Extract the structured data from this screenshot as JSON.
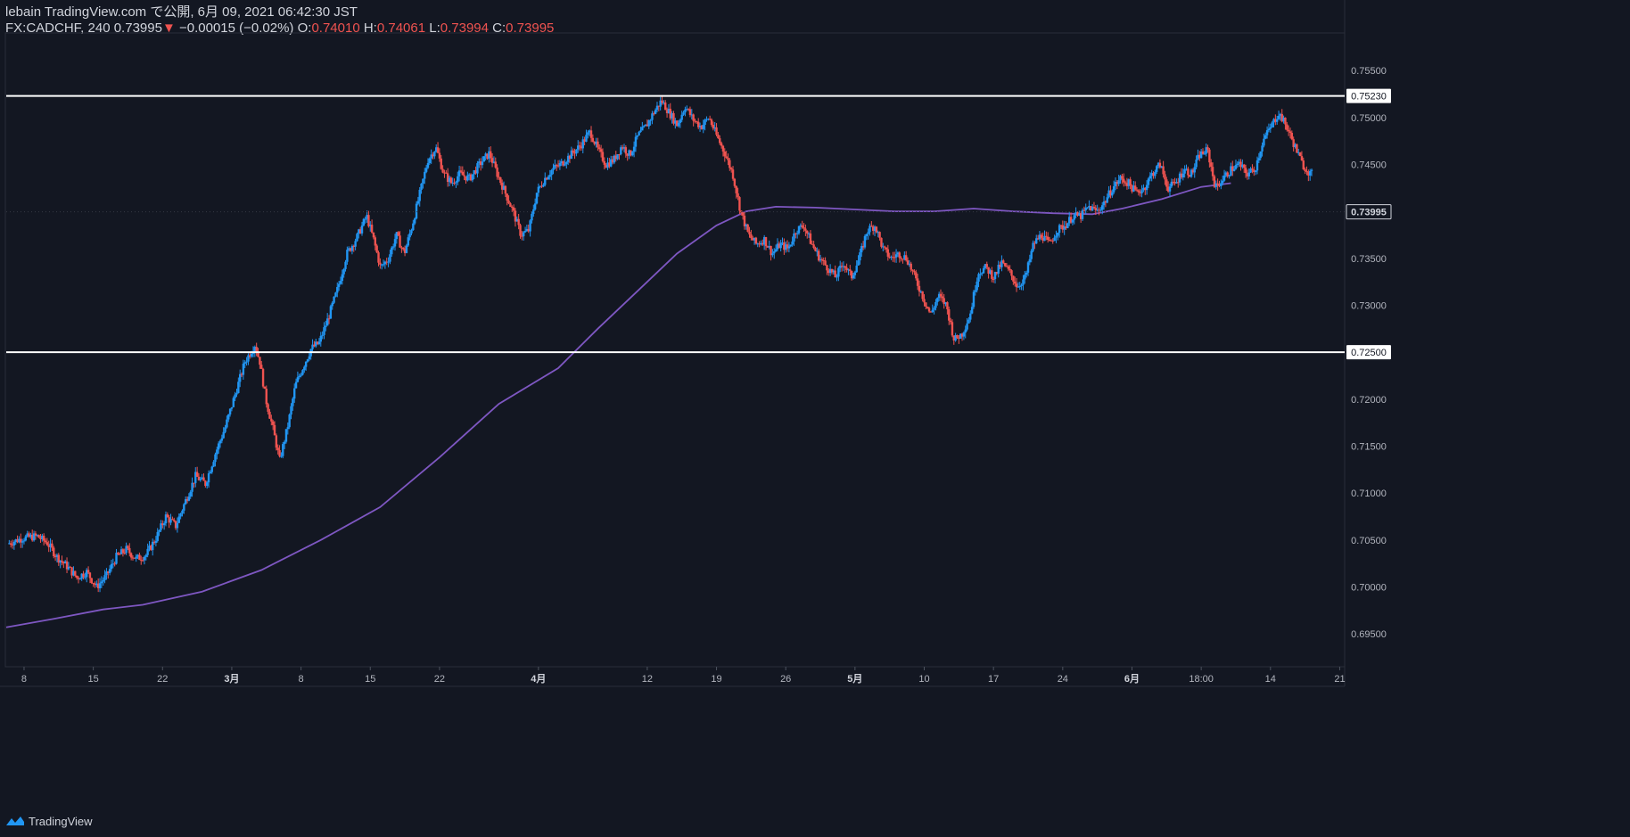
{
  "header": {
    "line1": "lebain TradingView.com で公開, 6月 09, 2021 06:42:30 JST",
    "symbol": "FX:CADCHF, 240",
    "last": "0.73995",
    "down_arrow": "▼",
    "change": "−0.00015 (−0.02%)",
    "o_label": "O:",
    "o_value": "0.74010",
    "h_label": "H:",
    "h_value": "0.74061",
    "l_label": "L:",
    "l_value": "0.73994",
    "c_label": "C:",
    "c_value": "0.73995"
  },
  "footer": {
    "brand": "TradingView"
  },
  "colors": {
    "background": "#131722",
    "up": "#2196f3",
    "down": "#ef5350",
    "ma": "#7e57c2",
    "hline": "#ffffff",
    "axis_text": "#b2b5be"
  },
  "chart_data": {
    "type": "candlestick",
    "symbol": "FX:CADCHF",
    "interval": "240",
    "ylim": [
      0.6915,
      0.759
    ],
    "y_ticks": [
      "0.75500",
      "0.75000",
      "0.74500",
      "0.74000",
      "0.73500",
      "0.73000",
      "0.72500",
      "0.72000",
      "0.71500",
      "0.71000",
      "0.70500",
      "0.70000",
      "0.69500"
    ],
    "x_ticks": [
      "8",
      "15",
      "22",
      "3月",
      "8",
      "15",
      "22",
      "4月",
      "12",
      "19",
      "26",
      "5月",
      "10",
      "17",
      "24",
      "6月",
      "18:00",
      "14",
      "21"
    ],
    "x_tick_days": [
      0,
      7,
      14,
      21,
      28,
      35,
      42,
      52,
      63,
      70,
      77,
      84,
      91,
      98,
      105,
      112,
      119,
      126,
      133
    ],
    "x_range_days": [
      -1.8,
      133.5
    ],
    "horizontal_lines": [
      {
        "value": 0.7523,
        "label": "0.75230"
      },
      {
        "value": 0.725,
        "label": "0.72500"
      }
    ],
    "last_price": {
      "value": 0.73995,
      "label": "0.73995"
    },
    "ma_points": [
      [
        -1.8,
        0.6957
      ],
      [
        3,
        0.6966
      ],
      [
        8,
        0.6976
      ],
      [
        12,
        0.6981
      ],
      [
        18,
        0.6995
      ],
      [
        24,
        0.7018
      ],
      [
        30,
        0.705
      ],
      [
        36,
        0.7085
      ],
      [
        42,
        0.7138
      ],
      [
        48,
        0.7195
      ],
      [
        54,
        0.7233
      ],
      [
        58,
        0.7275
      ],
      [
        62,
        0.7315
      ],
      [
        66,
        0.7355
      ],
      [
        70,
        0.7385
      ],
      [
        73,
        0.74
      ],
      [
        76,
        0.7405
      ],
      [
        80,
        0.7404
      ],
      [
        84,
        0.7402
      ],
      [
        88,
        0.74
      ],
      [
        92,
        0.74
      ],
      [
        96,
        0.7403
      ],
      [
        100,
        0.74
      ],
      [
        104,
        0.7398
      ],
      [
        108,
        0.7397
      ],
      [
        111,
        0.7403
      ],
      [
        115,
        0.7413
      ],
      [
        119,
        0.7426
      ],
      [
        122,
        0.743
      ]
    ],
    "price_path": [
      [
        -1.5,
        0.7046
      ],
      [
        0,
        0.7052
      ],
      [
        1.5,
        0.7054
      ],
      [
        2.5,
        0.7047
      ],
      [
        3.5,
        0.7032
      ],
      [
        4.5,
        0.7022
      ],
      [
        5.5,
        0.701
      ],
      [
        6.5,
        0.7016
      ],
      [
        7.5,
        0.7
      ],
      [
        8.5,
        0.7012
      ],
      [
        9.5,
        0.7032
      ],
      [
        10.5,
        0.704
      ],
      [
        11.5,
        0.703
      ],
      [
        12.5,
        0.7034
      ],
      [
        13.5,
        0.7052
      ],
      [
        14.5,
        0.7075
      ],
      [
        15.5,
        0.7065
      ],
      [
        16.5,
        0.7092
      ],
      [
        17.5,
        0.7118
      ],
      [
        18.5,
        0.711
      ],
      [
        19.5,
        0.7142
      ],
      [
        20.5,
        0.717
      ],
      [
        21.5,
        0.7205
      ],
      [
        22.5,
        0.724
      ],
      [
        23.5,
        0.7258
      ],
      [
        24,
        0.724
      ],
      [
        24.6,
        0.72
      ],
      [
        25.3,
        0.717
      ],
      [
        26,
        0.7135
      ],
      [
        26.8,
        0.717
      ],
      [
        27.6,
        0.7215
      ],
      [
        28.4,
        0.7235
      ],
      [
        29.2,
        0.7254
      ],
      [
        30,
        0.726
      ],
      [
        30.8,
        0.7283
      ],
      [
        31.8,
        0.7315
      ],
      [
        32.8,
        0.7355
      ],
      [
        33.8,
        0.7372
      ],
      [
        34.8,
        0.7395
      ],
      [
        35.5,
        0.737
      ],
      [
        36.2,
        0.734
      ],
      [
        37,
        0.735
      ],
      [
        37.8,
        0.7375
      ],
      [
        38.6,
        0.7355
      ],
      [
        39.4,
        0.7385
      ],
      [
        40.2,
        0.742
      ],
      [
        41,
        0.7455
      ],
      [
        41.8,
        0.7468
      ],
      [
        42.6,
        0.744
      ],
      [
        43.4,
        0.743
      ],
      [
        44.2,
        0.744
      ],
      [
        45.2,
        0.7435
      ],
      [
        46.2,
        0.745
      ],
      [
        47.2,
        0.7462
      ],
      [
        48,
        0.744
      ],
      [
        48.8,
        0.742
      ],
      [
        49.6,
        0.74
      ],
      [
        50.4,
        0.7375
      ],
      [
        51.2,
        0.738
      ],
      [
        52,
        0.742
      ],
      [
        52.8,
        0.7435
      ],
      [
        53.6,
        0.7445
      ],
      [
        54.4,
        0.745
      ],
      [
        55.4,
        0.746
      ],
      [
        56.4,
        0.747
      ],
      [
        57.4,
        0.7485
      ],
      [
        58.2,
        0.7465
      ],
      [
        59,
        0.745
      ],
      [
        59.8,
        0.7455
      ],
      [
        60.6,
        0.747
      ],
      [
        61.4,
        0.746
      ],
      [
        62.2,
        0.748
      ],
      [
        63,
        0.749
      ],
      [
        63.8,
        0.7505
      ],
      [
        64.6,
        0.7518
      ],
      [
        65.4,
        0.7505
      ],
      [
        66.2,
        0.7492
      ],
      [
        67,
        0.7512
      ],
      [
        67.8,
        0.7498
      ],
      [
        68.6,
        0.749
      ],
      [
        69.4,
        0.75
      ],
      [
        70.2,
        0.748
      ],
      [
        71,
        0.7462
      ],
      [
        71.8,
        0.744
      ],
      [
        72.6,
        0.74
      ],
      [
        73.4,
        0.7375
      ],
      [
        74.2,
        0.7365
      ],
      [
        75,
        0.737
      ],
      [
        75.8,
        0.7355
      ],
      [
        76.6,
        0.7365
      ],
      [
        77.4,
        0.736
      ],
      [
        78.2,
        0.738
      ],
      [
        79,
        0.7385
      ],
      [
        79.8,
        0.7365
      ],
      [
        80.6,
        0.735
      ],
      [
        81.4,
        0.734
      ],
      [
        82.2,
        0.733
      ],
      [
        83,
        0.7345
      ],
      [
        83.8,
        0.733
      ],
      [
        84.6,
        0.735
      ],
      [
        85.4,
        0.738
      ],
      [
        86.2,
        0.7385
      ],
      [
        87,
        0.736
      ],
      [
        87.8,
        0.735
      ],
      [
        88.6,
        0.7355
      ],
      [
        89.4,
        0.735
      ],
      [
        90.2,
        0.733
      ],
      [
        91,
        0.731
      ],
      [
        91.8,
        0.729
      ],
      [
        92.6,
        0.731
      ],
      [
        93.4,
        0.73
      ],
      [
        94.2,
        0.7263
      ],
      [
        95,
        0.727
      ],
      [
        95.8,
        0.729
      ],
      [
        96.6,
        0.7335
      ],
      [
        97.4,
        0.734
      ],
      [
        98.2,
        0.733
      ],
      [
        99,
        0.7345
      ],
      [
        99.8,
        0.7335
      ],
      [
        100.6,
        0.732
      ],
      [
        101.4,
        0.733
      ],
      [
        102.2,
        0.7365
      ],
      [
        103,
        0.7375
      ],
      [
        103.8,
        0.7365
      ],
      [
        104.6,
        0.738
      ],
      [
        105.4,
        0.7385
      ],
      [
        106.2,
        0.7395
      ],
      [
        107,
        0.7395
      ],
      [
        107.8,
        0.7405
      ],
      [
        108.6,
        0.74
      ],
      [
        109.4,
        0.741
      ],
      [
        110.2,
        0.7425
      ],
      [
        111,
        0.7435
      ],
      [
        111.8,
        0.743
      ],
      [
        112.6,
        0.742
      ],
      [
        113.4,
        0.7425
      ],
      [
        114.2,
        0.744
      ],
      [
        115,
        0.745
      ],
      [
        115.8,
        0.7425
      ],
      [
        116.6,
        0.743
      ],
      [
        117.4,
        0.7445
      ],
      [
        118.2,
        0.744
      ],
      [
        119,
        0.746
      ],
      [
        119.8,
        0.7465
      ],
      [
        120.6,
        0.7425
      ],
      [
        121.4,
        0.7435
      ],
      [
        122.2,
        0.7445
      ],
      [
        123,
        0.745
      ],
      [
        123.8,
        0.744
      ],
      [
        124.6,
        0.7445
      ],
      [
        125.4,
        0.7475
      ],
      [
        126.2,
        0.749
      ],
      [
        127,
        0.7505
      ],
      [
        127.8,
        0.749
      ],
      [
        128.6,
        0.747
      ],
      [
        129.4,
        0.745
      ],
      [
        130.2,
        0.744
      ]
    ]
  }
}
